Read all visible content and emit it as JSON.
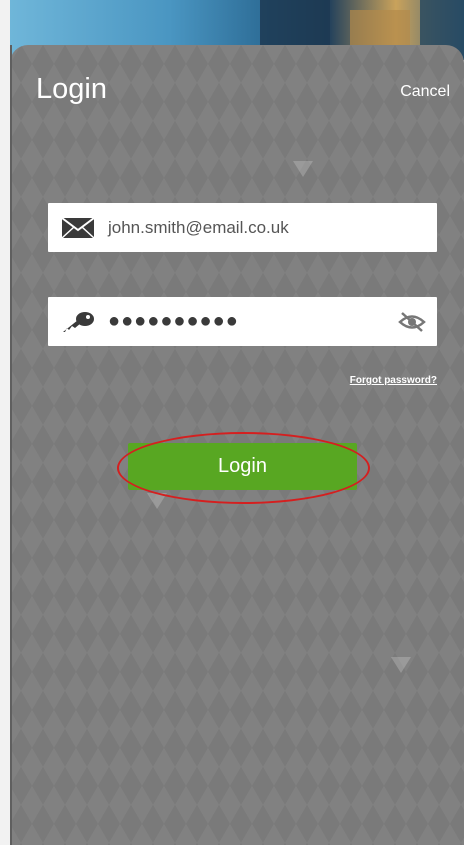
{
  "header": {
    "title": "Login",
    "cancel_label": "Cancel"
  },
  "form": {
    "email": {
      "value": "john.smith@email.co.uk",
      "icon": "envelope-icon"
    },
    "password": {
      "value": "●●●●●●●●●●",
      "icon": "key-icon",
      "toggle_icon": "eye-slash-icon"
    },
    "forgot_password_label": "Forgot password?",
    "submit_label": "Login"
  },
  "colors": {
    "panel": "#7a7a7a",
    "accent": "#58a722",
    "highlight": "#d51f1f"
  }
}
